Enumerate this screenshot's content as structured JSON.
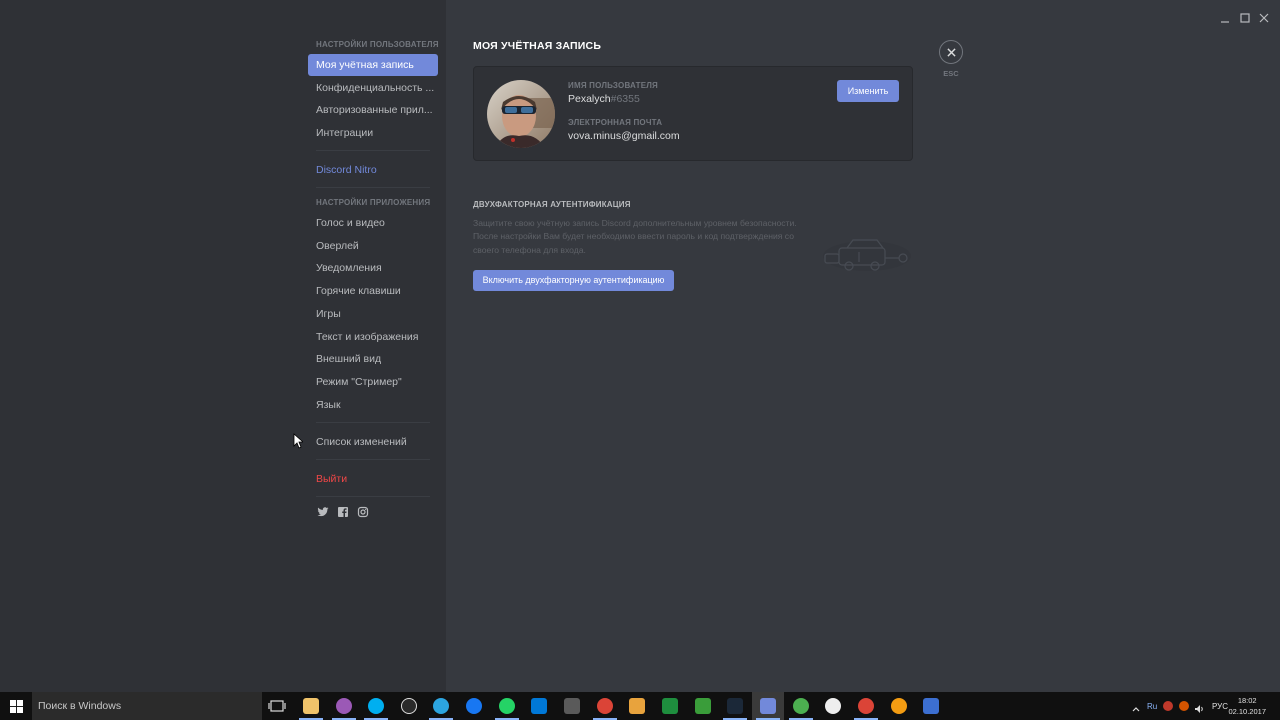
{
  "sidebar": {
    "user_settings_header": "Настройки пользователя",
    "user_items": [
      {
        "label": "Моя учётная запись"
      },
      {
        "label": "Конфиденциальность ..."
      },
      {
        "label": "Авторизованные прил..."
      },
      {
        "label": "Интеграции"
      }
    ],
    "nitro_label": "Discord Nitro",
    "app_settings_header": "Настройки приложения",
    "app_items": [
      {
        "label": "Голос и видео"
      },
      {
        "label": "Оверлей"
      },
      {
        "label": "Уведомления"
      },
      {
        "label": "Горячие клавиши"
      },
      {
        "label": "Игры"
      },
      {
        "label": "Текст и изображения"
      },
      {
        "label": "Внешний вид"
      },
      {
        "label": "Режим \"Стример\""
      },
      {
        "label": "Язык"
      }
    ],
    "changelog_label": "Список изменений",
    "logout_label": "Выйти",
    "social_icons": [
      "twitter-icon",
      "facebook-icon",
      "instagram-icon"
    ]
  },
  "account": {
    "page_title": "Моя учётная запись",
    "username_label": "Имя пользователя",
    "username": "Pexalych",
    "discriminator": "#6355",
    "email_label": "Электронная почта",
    "email": "vova.minus@gmail.com",
    "edit_button": "Изменить"
  },
  "tfa": {
    "header": "Двухфакторная аутентификация",
    "description": "Защитите свою учётную запись Discord дополнительным уровнем безопасности. После настройки Вам будет необходимо ввести пароль и код подтверждения со своего телефона для входа.",
    "button": "Включить двухфакторную аутентификацию"
  },
  "close": {
    "esc_label": "ESC"
  },
  "taskbar": {
    "search_placeholder": "Поиск в Windows",
    "language": "РУС",
    "keyboard_badge": "Ru",
    "time": "18:02",
    "date": "02.10.2017"
  },
  "colors": {
    "accent": "#7289da",
    "danger": "#f04747",
    "sidebar_bg": "#2f3136",
    "content_bg": "#36393f"
  }
}
